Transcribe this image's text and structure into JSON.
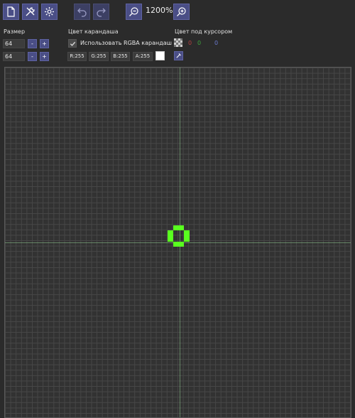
{
  "toolbar": {
    "buttons": [
      "new-file-icon",
      "tools-icon",
      "settings-icon",
      "undo-icon",
      "redo-icon",
      "zoom-out-icon",
      "zoom-in-icon"
    ],
    "zoom": "1200%"
  },
  "size": {
    "label": "Размер",
    "width": "64",
    "height": "64",
    "minus": "-",
    "plus": "+"
  },
  "pencil": {
    "label": "Цвет карандаша",
    "use_rgba_label": "Использовать RGBA карандаш",
    "use_rgba_checked": true,
    "r": "R:255",
    "g": "G:255",
    "b": "B:255",
    "a": "A:255",
    "color": "#ffffff"
  },
  "cursor_color": {
    "label": "Цвет под курсором",
    "r": "0",
    "g": "0",
    "b": "0"
  },
  "canvas": {
    "grid_cells": 64,
    "pixel_color": "#59ff1f",
    "pixels": [
      [
        31,
        29
      ],
      [
        32,
        29
      ],
      [
        30,
        30
      ],
      [
        33,
        30
      ],
      [
        30,
        31
      ],
      [
        33,
        31
      ],
      [
        31,
        32
      ],
      [
        32,
        32
      ]
    ]
  }
}
